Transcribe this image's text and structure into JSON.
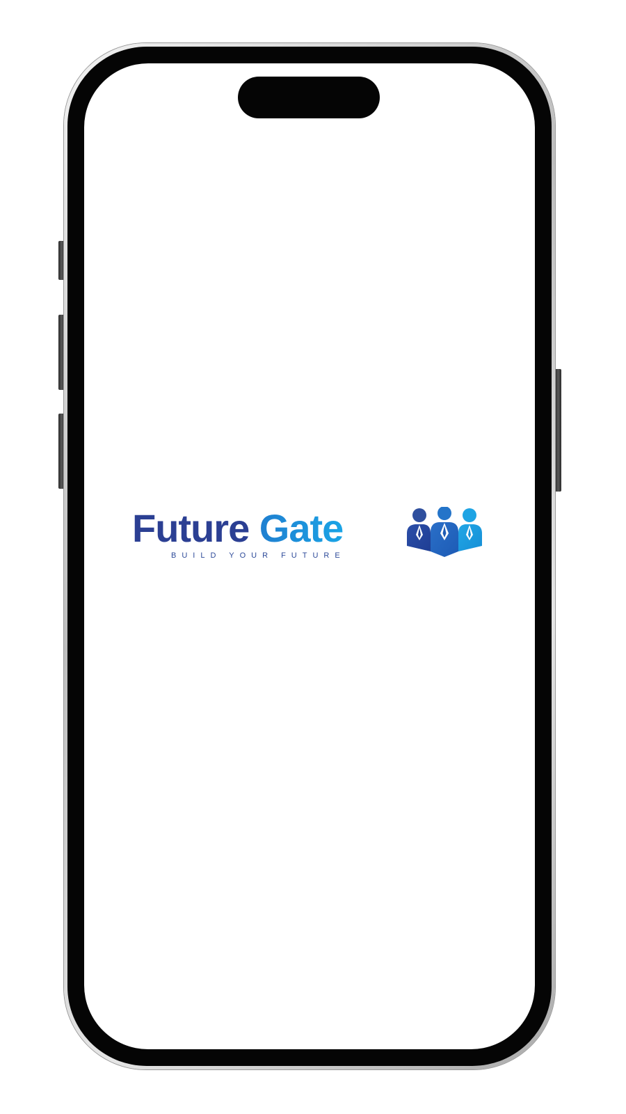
{
  "brand": {
    "name_part1": "Future",
    "name_part2": "Gate",
    "tagline": "BUILD YOUR FUTURE",
    "icon": "people-group-icon"
  },
  "colors": {
    "primary_dark": "#2b3f93",
    "primary_light": "#1aa4e6",
    "phone_bezel": "#050505",
    "screen_background": "#ffffff"
  }
}
